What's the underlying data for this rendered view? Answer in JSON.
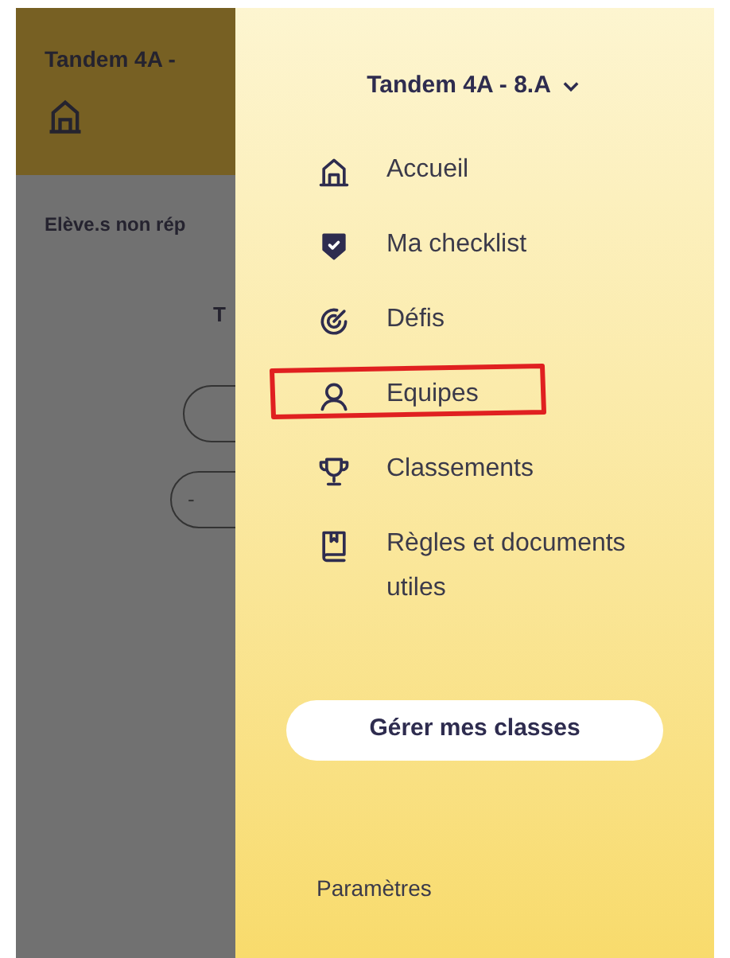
{
  "background": {
    "title": "Tandem 4A -",
    "subtitle": "Elève.s non rép",
    "label": "T",
    "pill_text": "-"
  },
  "drawer": {
    "class_selector": "Tandem 4A - 8.A",
    "items": [
      {
        "kind": "home",
        "label": "Accueil",
        "circled": false
      },
      {
        "kind": "checklist",
        "label": "Ma checklist",
        "circled": false
      },
      {
        "kind": "target",
        "label": "Défis",
        "circled": false
      },
      {
        "kind": "person",
        "label": "Equipes",
        "circled": true
      },
      {
        "kind": "trophy",
        "label": "Classements",
        "circled": false
      },
      {
        "kind": "book",
        "label": "Règles et documents utiles",
        "circled": false
      }
    ],
    "manage_button": "Gérer mes classes",
    "settings": "Paramètres"
  }
}
